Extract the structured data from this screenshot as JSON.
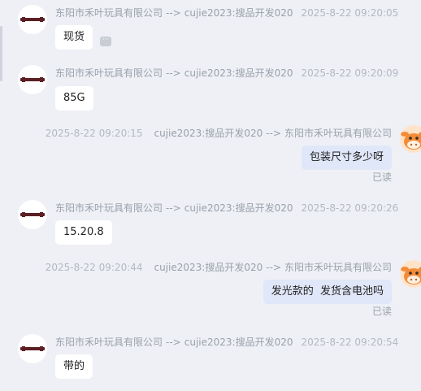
{
  "conversation": {
    "shop_name": "东阳市禾叶玩具有限公司",
    "agent_name": "cujie2023:搜品开发020",
    "arrow": "-->",
    "read_label": "已读",
    "messages": [
      {
        "direction": "in",
        "from": "东阳市禾叶玩具有限公司",
        "to": "cujie2023:搜品开发020",
        "time": "2025-8-22 09:20:05",
        "text": "现货"
      },
      {
        "direction": "in",
        "from": "东阳市禾叶玩具有限公司",
        "to": "cujie2023:搜品开发020",
        "time": "2025-8-22 09:20:09",
        "text": "85G"
      },
      {
        "direction": "out",
        "from": "cujie2023:搜品开发020",
        "to": "东阳市禾叶玩具有限公司",
        "time": "2025-8-22 09:20:15",
        "text": "包装尺寸多少呀",
        "status": "已读"
      },
      {
        "direction": "in",
        "from": "东阳市禾叶玩具有限公司",
        "to": "cujie2023:搜品开发020",
        "time": "2025-8-22 09:20:26",
        "text": "15.20.8"
      },
      {
        "direction": "out",
        "from": "cujie2023:搜品开发020",
        "to": "东阳市禾叶玩具有限公司",
        "time": "2025-8-22 09:20:44",
        "text": "发光款的  发货含电池吗",
        "status": "已读"
      },
      {
        "direction": "in",
        "from": "东阳市禾叶玩具有限公司",
        "to": "cujie2023:搜品开发020",
        "time": "2025-8-22 09:20:54",
        "text": "带的"
      }
    ]
  },
  "icons": {
    "more": "more-icon",
    "shop_avatar": "shop-logo-avatar",
    "agent_avatar": "cow-avatar"
  },
  "colors": {
    "background": "#eef0f5",
    "incoming_bubble": "#ffffff",
    "outgoing_bubble": "#dfe7f8",
    "meta_text": "#9aa0ab",
    "logo": "#5b1f24",
    "cow_orange": "#f28c38"
  }
}
